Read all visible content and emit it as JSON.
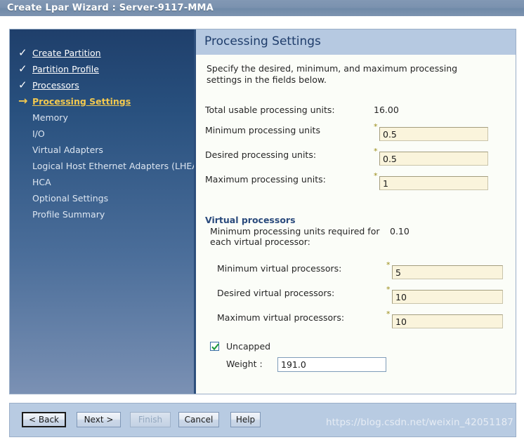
{
  "window": {
    "title": "Create Lpar Wizard : Server-9117-MMA"
  },
  "sidebar": {
    "items": [
      {
        "label": "Create Partition",
        "marker": "check-icon",
        "state": "done"
      },
      {
        "label": "Partition Profile",
        "marker": "check-icon",
        "state": "done"
      },
      {
        "label": "Processors",
        "marker": "check-icon",
        "state": "done"
      },
      {
        "label": "Processing Settings",
        "marker": "arrow-right-icon",
        "state": "current"
      },
      {
        "label": "Memory",
        "marker": "",
        "state": "pending"
      },
      {
        "label": "I/O",
        "marker": "",
        "state": "pending"
      },
      {
        "label": "Virtual Adapters",
        "marker": "",
        "state": "pending"
      },
      {
        "label": "Logical Host Ethernet Adapters (LHEA)",
        "marker": "",
        "state": "pending"
      },
      {
        "label": "HCA",
        "marker": "",
        "state": "pending"
      },
      {
        "label": "Optional Settings",
        "marker": "",
        "state": "pending"
      },
      {
        "label": "Profile Summary",
        "marker": "",
        "state": "pending"
      }
    ]
  },
  "content": {
    "header_title": "Processing Settings",
    "description": "Specify the desired, minimum, and maximum processing settings in the fields below.",
    "total_usable_label": "Total usable processing units:",
    "total_usable_value": "16.00",
    "fields": [
      {
        "label": "Minimum processing units",
        "value": "0.5",
        "required": "*"
      },
      {
        "label": "Desired processing units:",
        "value": "0.5",
        "required": "*"
      },
      {
        "label": "Maximum processing units:",
        "value": "1",
        "required": "*"
      }
    ],
    "virtual_section": {
      "title": "Virtual processors",
      "note": "Minimum processing units required for each virtual processor:",
      "note_value": "0.10",
      "fields": [
        {
          "label": "Minimum virtual processors:",
          "value": "5",
          "required": "*"
        },
        {
          "label": "Desired virtual processors:",
          "value": "10",
          "required": "*"
        },
        {
          "label": "Maximum virtual processors:",
          "value": "10",
          "required": "*"
        }
      ]
    },
    "uncapped": {
      "label": "Uncapped",
      "checked": "true",
      "weight_label": "Weight :",
      "weight_value": "191.0"
    }
  },
  "buttons": {
    "back": "< Back",
    "next": "Next >",
    "finish": "Finish",
    "cancel": "Cancel",
    "help": "Help"
  },
  "watermark": "https://blog.csdn.net/weixin_42051187",
  "colors": {
    "titlebar": "#7b92af",
    "sidebar_top": "#1f3f6b",
    "sidebar_bottom": "#7b91b4",
    "header_band": "#b6c9e1",
    "current_item": "#f3c94f",
    "section_heading": "#2a4a7c",
    "input_bg": "#faf4dc",
    "required_star": "#9a8b16",
    "check_green": "#1f9a3c"
  }
}
